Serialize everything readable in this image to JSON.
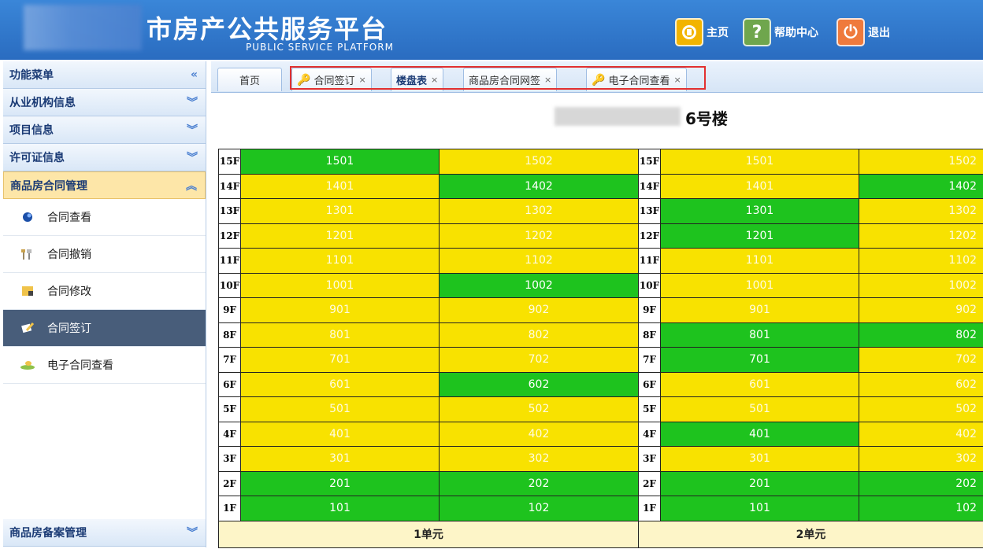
{
  "header": {
    "title_cn": "市房产公共服务平台",
    "title_en": "PUBLIC SERVICE PLATFORM",
    "buttons": [
      {
        "label": "主页",
        "icon": "home-icon",
        "color": "#f2b400"
      },
      {
        "label": "帮助中心",
        "icon": "help-icon",
        "glyph": "?",
        "color": "#6fa64d"
      },
      {
        "label": "退出",
        "icon": "power-icon",
        "glyph": "⏻",
        "color": "#ef7a3c"
      }
    ]
  },
  "sidebar": {
    "menu_title": "功能菜单",
    "menu_icon": "«",
    "sections": [
      "从业机构信息",
      "项目信息",
      "许可证信息"
    ],
    "active_section": "商品房合同管理",
    "items": [
      {
        "label": "合同查看",
        "icon": "view-icon"
      },
      {
        "label": "合同撤销",
        "icon": "revoke-icon"
      },
      {
        "label": "合同修改",
        "icon": "edit-icon"
      },
      {
        "label": "合同签订",
        "icon": "sign-icon",
        "selected": true
      },
      {
        "label": "电子合同查看",
        "icon": "econtract-icon"
      }
    ],
    "bottom_section": "商品房备案管理"
  },
  "tabs": [
    {
      "label": "首页"
    },
    {
      "label": "合同签订",
      "closable": true,
      "key": true
    },
    {
      "label": "楼盘表",
      "closable": true
    },
    {
      "label": "商品房合同网签",
      "closable": true
    },
    {
      "label": "电子合同查看",
      "closable": true,
      "key": true
    }
  ],
  "building": {
    "title": "6号楼",
    "floors": [
      "15F",
      "14F",
      "13F",
      "12F",
      "11F",
      "10F",
      "9F",
      "8F",
      "7F",
      "6F",
      "5F",
      "4F",
      "3F",
      "2F",
      "1F"
    ],
    "unit1": [
      [
        "1501",
        "g",
        "1502",
        "y"
      ],
      [
        "1401",
        "y",
        "1402",
        "g"
      ],
      [
        "1301",
        "y",
        "1302",
        "y"
      ],
      [
        "1201",
        "y",
        "1202",
        "y"
      ],
      [
        "1101",
        "y",
        "1102",
        "y"
      ],
      [
        "1001",
        "y",
        "1002",
        "g"
      ],
      [
        "901",
        "y",
        "902",
        "y"
      ],
      [
        "801",
        "y",
        "802",
        "y"
      ],
      [
        "701",
        "y",
        "702",
        "y"
      ],
      [
        "601",
        "y",
        "602",
        "g"
      ],
      [
        "501",
        "y",
        "502",
        "y"
      ],
      [
        "401",
        "y",
        "402",
        "y"
      ],
      [
        "301",
        "y",
        "302",
        "y"
      ],
      [
        "201",
        "g",
        "202",
        "g"
      ],
      [
        "101",
        "g",
        "102",
        "g"
      ]
    ],
    "unit2": [
      [
        "1501",
        "y",
        "1502",
        "y"
      ],
      [
        "1401",
        "y",
        "1402",
        "g"
      ],
      [
        "1301",
        "g",
        "1302",
        "y"
      ],
      [
        "1201",
        "g",
        "1202",
        "y"
      ],
      [
        "1101",
        "y",
        "1102",
        "y"
      ],
      [
        "1001",
        "y",
        "1002",
        "y"
      ],
      [
        "901",
        "y",
        "902",
        "y"
      ],
      [
        "801",
        "g",
        "802",
        "g"
      ],
      [
        "701",
        "g",
        "702",
        "y"
      ],
      [
        "601",
        "y",
        "602",
        "y"
      ],
      [
        "501",
        "y",
        "502",
        "y"
      ],
      [
        "401",
        "g",
        "402",
        "y"
      ],
      [
        "301",
        "y",
        "302",
        "y"
      ],
      [
        "201",
        "g",
        "202",
        "g"
      ],
      [
        "101",
        "g",
        "102",
        "g"
      ]
    ],
    "unit_labels": [
      "1单元",
      "2单元"
    ]
  }
}
